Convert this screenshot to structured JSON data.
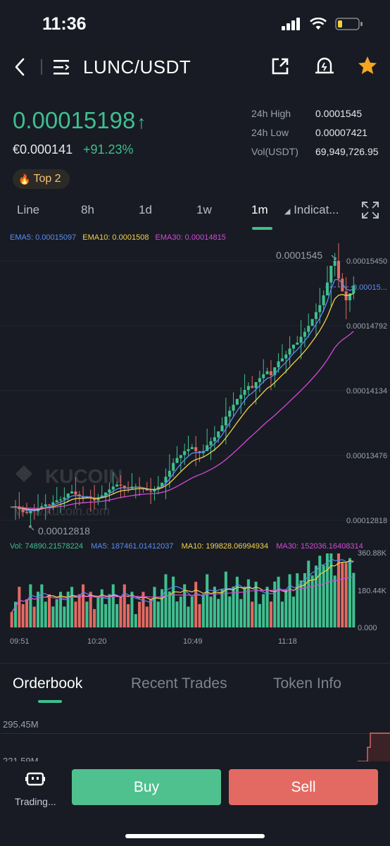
{
  "status": {
    "time": "11:36"
  },
  "header": {
    "pair": "LUNC/USDT"
  },
  "ticker": {
    "price": "0.00015198",
    "arrow": "↑",
    "eur": "€0.000141",
    "change": "+91.23%",
    "badge": "Top 2",
    "stats": [
      {
        "label": "24h High",
        "value": "0.0001545"
      },
      {
        "label": "24h Low",
        "value": "0.00007421"
      },
      {
        "label": "Vol(USDT)",
        "value": "69,949,726.95"
      }
    ]
  },
  "timeframes": {
    "items": [
      "Line",
      "8h",
      "1d",
      "1w",
      "1m"
    ],
    "active": "1m",
    "indicators": "Indicat..."
  },
  "colors": {
    "green": "#3fbf8f",
    "red": "#e36a62",
    "ema5": "#5b8def",
    "ema10": "#f2d24b",
    "ema30": "#d24bd8"
  },
  "ema_legend": {
    "ema5": "EMA5: 0.00015097",
    "ema10": "EMA10: 0.0001508",
    "ema30": "EMA30: 0.00014815"
  },
  "vol_legend": {
    "vol": "Vol: 74890.21578224",
    "ma5": "MA5: 187461.01412037",
    "ma10": "MA10: 199828.06994934",
    "ma30": "MA30: 152036.16408314"
  },
  "chart_data": {
    "type": "candlestick",
    "price_axis": [
      "0.00015450",
      "0.00014792",
      "0.00014134",
      "0.00013476",
      "0.00012818"
    ],
    "price_ylim": [
      0.00012818,
      0.0001545
    ],
    "current_price_label": "0.00015...",
    "high_marker": "0.0001545",
    "low_marker": "0.00012818",
    "watermark": "KUCOIN",
    "watermark_url": "www.kucoin.com",
    "volume_axis": [
      "360.88K",
      "180.44K",
      "0.000"
    ],
    "time_axis": [
      "09:51",
      "10:20",
      "10:49",
      "11:18"
    ],
    "close_series": [
      0.0001295,
      0.0001296,
      0.0001293,
      0.000129,
      0.0001289,
      0.0001292,
      0.0001291,
      0.0001294,
      0.0001296,
      0.0001298,
      0.0001297,
      0.00013,
      0.0001302,
      0.0001303,
      0.0001305,
      0.0001309,
      0.0001311,
      0.0001308,
      0.0001306,
      0.0001304,
      0.0001306,
      0.0001304,
      0.0001302,
      0.0001305,
      0.0001307,
      0.000131,
      0.0001313,
      0.0001316,
      0.0001318,
      0.0001317,
      0.0001315,
      0.0001314,
      0.0001316,
      0.0001316,
      0.0001315,
      0.0001314,
      0.0001312,
      0.0001311,
      0.0001313,
      0.0001316,
      0.000132,
      0.0001326,
      0.0001332,
      0.000134,
      0.0001345,
      0.0001348,
      0.0001352,
      0.0001354,
      0.0001356,
      0.0001352,
      0.000135,
      0.0001352,
      0.0001358,
      0.0001362,
      0.0001366,
      0.0001372,
      0.0001378,
      0.0001387,
      0.0001393,
      0.0001399,
      0.0001405,
      0.0001409,
      0.0001414,
      0.0001418,
      0.0001416,
      0.0001422,
      0.0001426,
      0.000143,
      0.0001433,
      0.0001429,
      0.0001437,
      0.0001443,
      0.0001446,
      0.000145,
      0.0001456,
      0.000146,
      0.0001462,
      0.0001468,
      0.0001473,
      0.0001479,
      0.0001486,
      0.0001493,
      0.00015,
      0.000151,
      0.0001523,
      0.000154,
      0.0001545,
      0.0001527,
      0.0001514,
      0.0001505,
      0.0001512,
      0.000152
    ]
  },
  "tabs": {
    "orderbook": "Orderbook",
    "recent": "Recent Trades",
    "token": "Token Info"
  },
  "depth": {
    "level1": "295.45M",
    "level2": "221.59M"
  },
  "bottom": {
    "trading": "Trading...",
    "buy": "Buy",
    "sell": "Sell"
  }
}
